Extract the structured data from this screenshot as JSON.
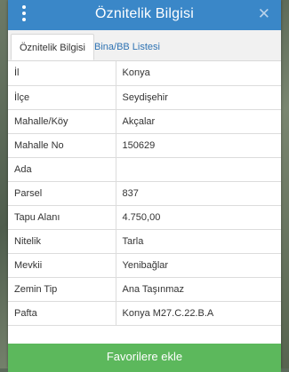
{
  "header": {
    "title": "Öznitelik Bilgisi"
  },
  "tabs": [
    {
      "label": "Öznitelik Bilgisi"
    },
    {
      "label": "Bina/BB Listesi"
    }
  ],
  "rows": [
    {
      "key": "İl",
      "value": "Konya"
    },
    {
      "key": "İlçe",
      "value": "Seydişehir"
    },
    {
      "key": "Mahalle/Köy",
      "value": "Akçalar"
    },
    {
      "key": "Mahalle No",
      "value": "150629"
    },
    {
      "key": "Ada",
      "value": ""
    },
    {
      "key": "Parsel",
      "value": "837"
    },
    {
      "key": "Tapu Alanı",
      "value": "4.750,00"
    },
    {
      "key": "Nitelik",
      "value": "Tarla"
    },
    {
      "key": "Mevkii",
      "value": "Yenibağlar"
    },
    {
      "key": "Zemin Tip",
      "value": "Ana Taşınmaz"
    },
    {
      "key": "Pafta",
      "value": "Konya M27.C.22.B.A"
    }
  ],
  "actions": {
    "favorite_label": "Favorilere ekle"
  },
  "colors": {
    "header": "#3a87c8",
    "button": "#5cb85c",
    "link": "#2f73b3"
  },
  "icons": {
    "menu": "vertical-dots-icon",
    "close": "close-icon"
  }
}
